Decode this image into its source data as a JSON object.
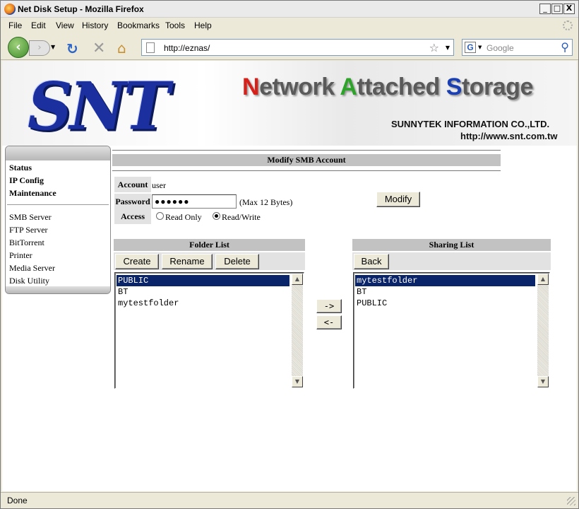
{
  "window": {
    "title": "Net Disk Setup - Mozilla Firefox",
    "minimize": "_",
    "maximize": "□",
    "close": "X"
  },
  "menu": [
    "File",
    "Edit",
    "View",
    "History",
    "Bookmarks",
    "Tools",
    "Help"
  ],
  "nav": {
    "url": "http://eznas/",
    "search_placeholder": "Google",
    "search_engine_letter": "G"
  },
  "banner": {
    "logo": "SNT",
    "title_parts": [
      {
        "t": "N",
        "c": "r"
      },
      {
        "t": "etwork ",
        "c": "k"
      },
      {
        "t": "A",
        "c": "g"
      },
      {
        "t": "ttached ",
        "c": "k"
      },
      {
        "t": "S",
        "c": "b"
      },
      {
        "t": "torage",
        "c": "k"
      }
    ],
    "company": "SUNNYTEK INFORMATION CO.,LTD.",
    "website": "http://www.snt.com.tw"
  },
  "sidebar": {
    "primary": [
      "Status",
      "IP Config",
      "Maintenance"
    ],
    "secondary": [
      "SMB Server",
      "FTP Server",
      "BitTorrent",
      "Printer",
      "Media Server",
      "Disk Utility"
    ]
  },
  "form": {
    "section_title": "Modify SMB Account",
    "account_label": "Account",
    "account_value": "user",
    "password_label": "Password",
    "password_value": "●●●●●●",
    "password_hint": "(Max 12 Bytes)",
    "access_label": "Access",
    "access_options": [
      "Read Only",
      "Read/Write"
    ],
    "access_selected": "Read/Write",
    "modify_button": "Modify"
  },
  "folder_list": {
    "title": "Folder List",
    "buttons": [
      "Create",
      "Rename",
      "Delete"
    ],
    "items": [
      "PUBLIC",
      "BT",
      "mytestfolder"
    ],
    "selected": "PUBLIC"
  },
  "transfer": {
    "add": "->",
    "remove": "<-"
  },
  "sharing_list": {
    "title": "Sharing List",
    "back_button": "Back",
    "items": [
      "mytestfolder",
      "BT",
      "PUBLIC"
    ],
    "selected": "mytestfolder"
  },
  "status": "Done"
}
